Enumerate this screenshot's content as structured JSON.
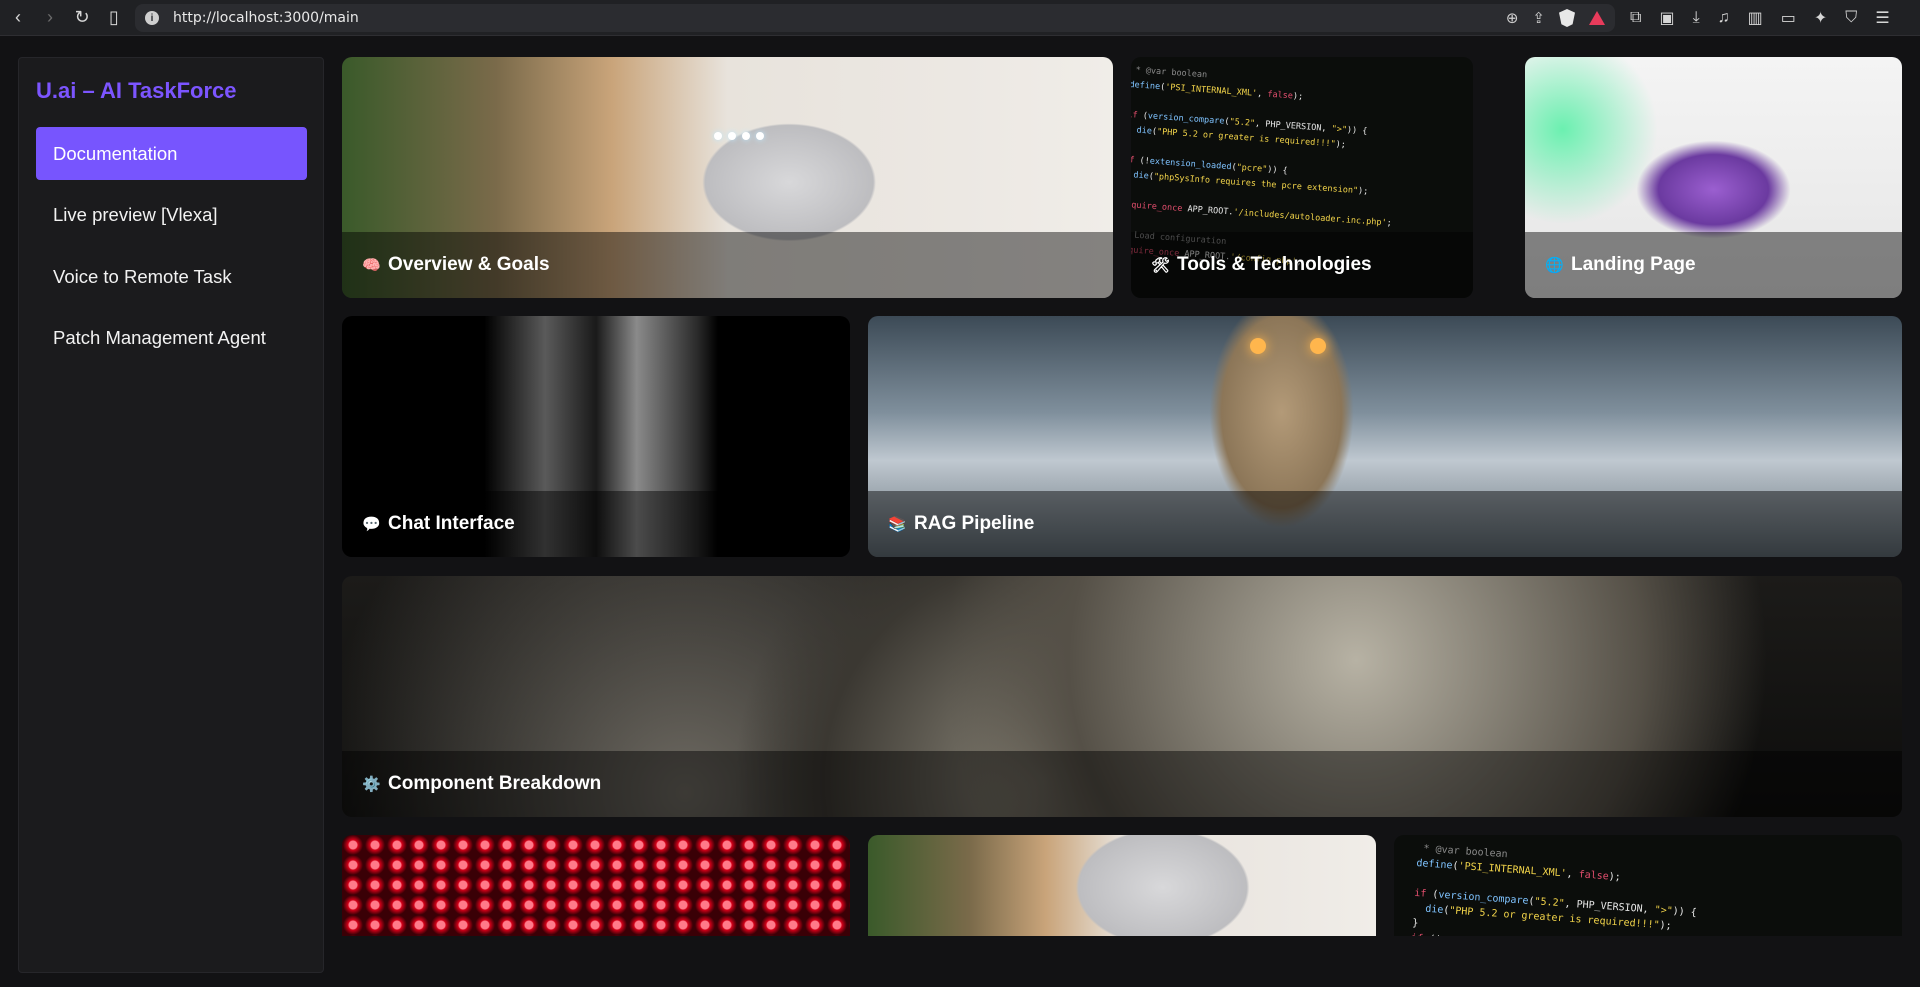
{
  "browser": {
    "url": "http://localhost:3000/main"
  },
  "sidebar": {
    "brand": "U.ai – AI TaskForce",
    "items": [
      {
        "label": "Documentation",
        "active": true
      },
      {
        "label": "Live preview [Vlexa]",
        "active": false
      },
      {
        "label": "Voice to Remote Task",
        "active": false
      },
      {
        "label": "Patch Management Agent",
        "active": false
      }
    ]
  },
  "cards": [
    {
      "emoji": "🧠",
      "label": "Overview & Goals",
      "image": "smart-speaker"
    },
    {
      "emoji": "🛠",
      "label": "Tools & Technologies",
      "image": "code"
    },
    {
      "emoji": "🌐",
      "label": "Landing Page",
      "image": "brain"
    },
    {
      "emoji": "💬",
      "label": "Chat Interface",
      "image": "microphone"
    },
    {
      "emoji": "📚",
      "label": "RAG Pipeline",
      "image": "robot"
    },
    {
      "emoji": "⚙️",
      "label": "Component Breakdown",
      "image": "gears"
    },
    {
      "emoji": "",
      "label": "",
      "image": "led"
    },
    {
      "emoji": "",
      "label": "",
      "image": "smart-speaker"
    },
    {
      "emoji": "",
      "label": "",
      "image": "code"
    }
  ],
  "colors": {
    "accent": "#7755fe",
    "brand": "#7c55ff",
    "background": "#121214",
    "sidebar": "#1b1b1d"
  }
}
